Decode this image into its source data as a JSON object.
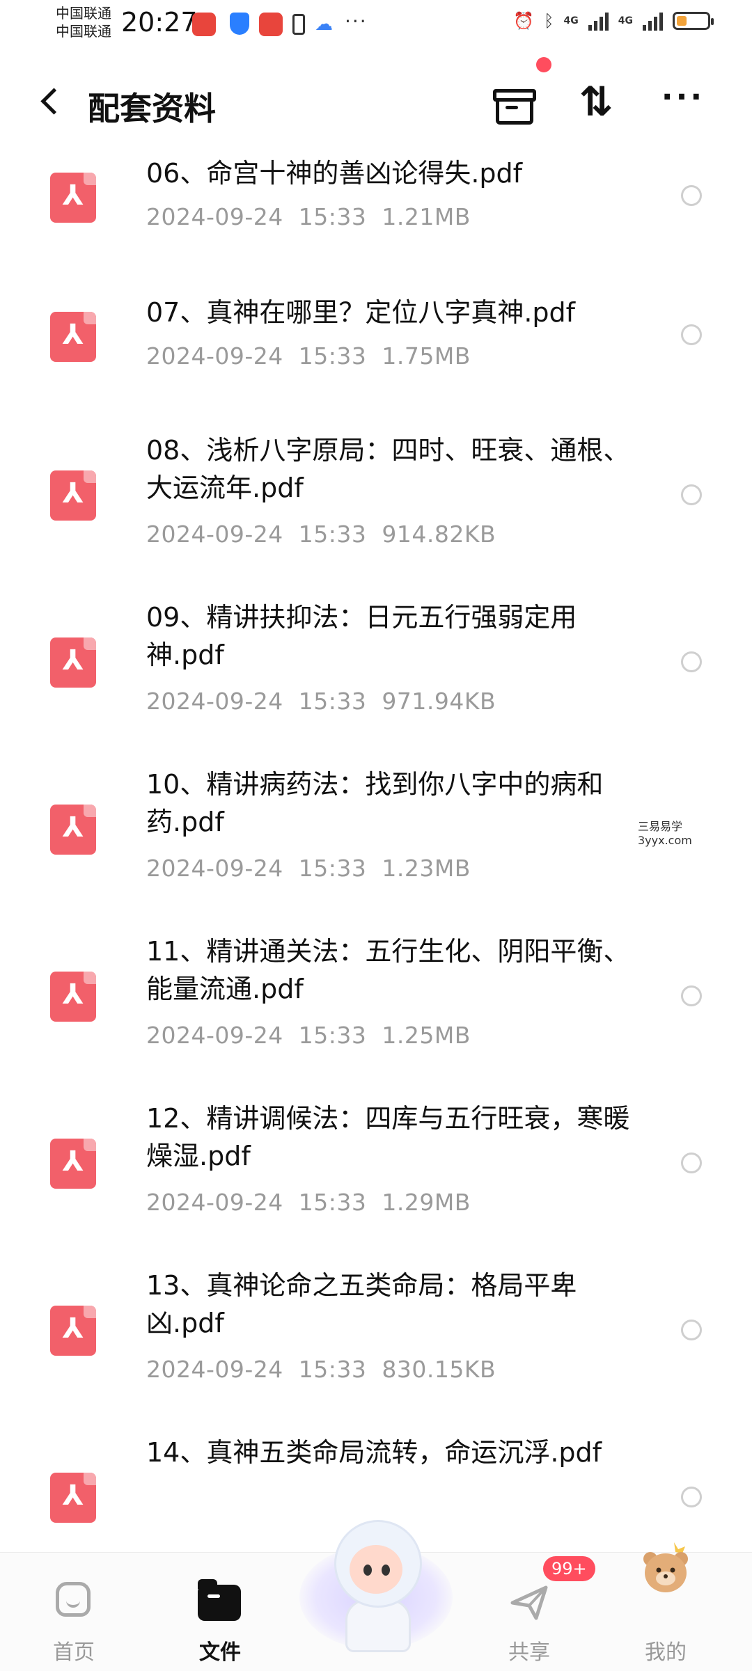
{
  "status_bar": {
    "carrier_1": "中国联通",
    "carrier_2": "中国联通",
    "time": "20:27",
    "network_1": "4G",
    "network_2": "4G",
    "more": "···"
  },
  "header": {
    "title": "配套资料",
    "sort_glyph": "⇅",
    "more_glyph": "···"
  },
  "files": [
    {
      "name": "06、命宫十神的善凶论得失.pdf",
      "date": "2024-09-24",
      "time": "15:33",
      "size": "1.21MB"
    },
    {
      "name": "07、真神在哪里？定位八字真神.pdf",
      "date": "2024-09-24",
      "time": "15:33",
      "size": "1.75MB"
    },
    {
      "name": "08、浅析八字原局：四时、旺衰、通根、大运流年.pdf",
      "date": "2024-09-24",
      "time": "15:33",
      "size": "914.82KB"
    },
    {
      "name": "09、精讲扶抑法：日元五行强弱定用神.pdf",
      "date": "2024-09-24",
      "time": "15:33",
      "size": "971.94KB"
    },
    {
      "name": "10、精讲病药法：找到你八字中的病和药.pdf",
      "date": "2024-09-24",
      "time": "15:33",
      "size": "1.23MB"
    },
    {
      "name": "11、精讲通关法：五行生化、阴阳平衡、能量流通.pdf",
      "date": "2024-09-24",
      "time": "15:33",
      "size": "1.25MB"
    },
    {
      "name": "12、精讲调候法：四库与五行旺衰，寒暖燥湿.pdf",
      "date": "2024-09-24",
      "time": "15:33",
      "size": "1.29MB"
    },
    {
      "name": "13、真神论命之五类命局：格局平卑凶.pdf",
      "date": "2024-09-24",
      "time": "15:33",
      "size": "830.15KB"
    },
    {
      "name": "14、真神五类命局流转，命运沉浮.pdf",
      "date": "",
      "time": "",
      "size": ""
    }
  ],
  "watermark": {
    "line1": "三易易学",
    "line2": "3yyx.com"
  },
  "nav": {
    "home": "首页",
    "files": "文件",
    "share": "共享",
    "share_badge": "99+",
    "mine": "我的"
  },
  "colors": {
    "pdf_icon": "#f2606a",
    "badge": "#ff4d5e",
    "meta_text": "#9a9a9a"
  }
}
